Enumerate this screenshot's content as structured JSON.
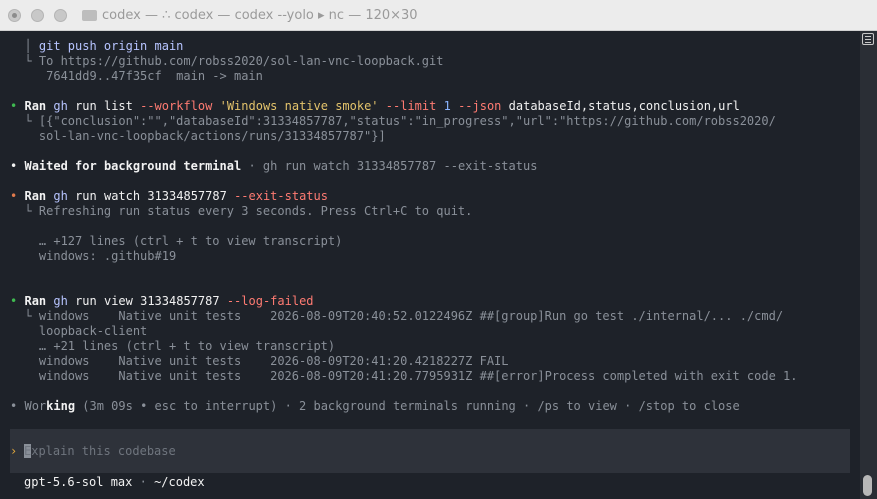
{
  "window": {
    "title": "codex — ∴ codex — codex --yolo ▸ nc — 120×30"
  },
  "transcript": {
    "push_cmd": "git push origin main",
    "push_to": "└ To https://github.com/robss2020/sol-lan-vnc-loopback.git",
    "push_ref": "   7641dd9..47f35cf  main -> main",
    "run1": {
      "bullet": "•",
      "ran": "Ran",
      "tool": "gh",
      "cmd": "run list",
      "flag1": "--workflow",
      "str1": "'Windows native smoke'",
      "flag2": "--limit",
      "num1": "1",
      "flag3": "--json",
      "fields": "databaseId,status,conclusion,url",
      "out1": "└ [{\"conclusion\":\"\",\"databaseId\":31334857787,\"status\":\"in_progress\",\"url\":\"https://github.com/robss2020/",
      "out2": "  sol-lan-vnc-loopback/actions/runs/31334857787\"}]"
    },
    "waited": {
      "bullet": "•",
      "label": "Waited for background terminal",
      "detail": " · gh run watch 31334857787 --exit-status"
    },
    "run2": {
      "bullet": "•",
      "ran": "Ran",
      "tool": "gh",
      "cmd": "run watch",
      "num": "31334857787",
      "flag": "--exit-status",
      "out1": "└ Refreshing run status every 3 seconds. Press Ctrl+C to quit.",
      "more": "  … +127 lines (ctrl + t to view transcript)",
      "out2": "  windows: .github#19"
    },
    "run3": {
      "bullet": "•",
      "ran": "Ran",
      "tool": "gh",
      "cmd": "run view",
      "num": "31334857787",
      "flag": "--log-failed",
      "out1": "└ windows    Native unit tests    2026-08-09T20:40:52.0122496Z ##[group]Run go test ./internal/... ./cmd/",
      "out2": "  loopback-client",
      "more": "  … +21 lines (ctrl + t to view transcript)",
      "out3": "  windows    Native unit tests    2026-08-09T20:41:20.4218227Z FAIL",
      "out4": "  windows    Native unit tests    2026-08-09T20:41:20.7795931Z ##[error]Process completed with exit code 1."
    },
    "working": {
      "bullet": "•",
      "dim_part": "Wor",
      "bright_part": "king",
      "detail": " (3m 09s • esc to interrupt) · 2 background terminals running · /ps to view · /stop to close"
    }
  },
  "composer": {
    "prompt": "›",
    "placeholder": "Explain this codebase"
  },
  "status_bar": {
    "model": "gpt-5.6-sol max",
    "sep": " · ",
    "cwd": "~/codex"
  }
}
